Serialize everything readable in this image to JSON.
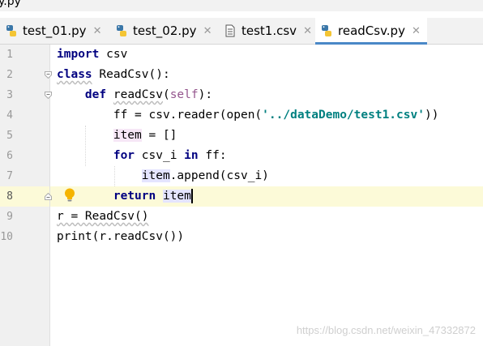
{
  "window": {
    "title_fragment": "y.py"
  },
  "tabs": [
    {
      "label": "test_01.py",
      "icon": "python-file-icon",
      "active": false
    },
    {
      "label": "test_02.py",
      "icon": "python-file-icon",
      "active": false
    },
    {
      "label": "test1.csv",
      "icon": "text-file-icon",
      "active": false
    },
    {
      "label": "readCsv.py",
      "icon": "python-file-icon",
      "active": true
    }
  ],
  "tab_close_glyph": "✕",
  "editor": {
    "line_numbers": [
      "1",
      "2",
      "3",
      "4",
      "5",
      "6",
      "7",
      "8",
      "9",
      "10"
    ],
    "current_line": "8",
    "lines": [
      [
        {
          "t": "import",
          "c": "kw"
        },
        {
          "t": " csv"
        }
      ],
      [
        {
          "t": "class",
          "c": "kw wavy"
        },
        {
          "t": " ReadCsv():"
        }
      ],
      [
        {
          "t": "    "
        },
        {
          "t": "def",
          "c": "kw"
        },
        {
          "t": " "
        },
        {
          "t": "readCsv",
          "c": "wavy"
        },
        {
          "t": "("
        },
        {
          "t": "self",
          "c": "self"
        },
        {
          "t": "):"
        }
      ],
      [
        {
          "t": "        ff = csv.reader(open("
        },
        {
          "t": "'../dataDemo/test1.csv'",
          "c": "str"
        },
        {
          "t": "))"
        }
      ],
      [
        {
          "t": "        "
        },
        {
          "t": "item",
          "c": "write"
        },
        {
          "t": " = []"
        }
      ],
      [
        {
          "t": "        "
        },
        {
          "t": "for",
          "c": "kw"
        },
        {
          "t": " csv_i "
        },
        {
          "t": "in",
          "c": "kw"
        },
        {
          "t": " ff:"
        }
      ],
      [
        {
          "t": "            "
        },
        {
          "t": "item",
          "c": "usage"
        },
        {
          "t": ".append(csv_i)"
        }
      ],
      [
        {
          "t": "        "
        },
        {
          "t": "return",
          "c": "kw"
        },
        {
          "t": " "
        },
        {
          "t": "item",
          "c": "usage"
        }
      ],
      [
        {
          "t": "r = ReadCsv()",
          "c": "wavy"
        }
      ],
      [
        {
          "t": "print(r.readCsv())"
        }
      ]
    ]
  },
  "colors": {
    "keyword": "#000080",
    "string": "#008080",
    "self": "#94558d",
    "caret_line": "#fcfad8",
    "active_tab_underline": "#4a88c7"
  },
  "watermark": "https://blog.csdn.net/weixin_47332872"
}
